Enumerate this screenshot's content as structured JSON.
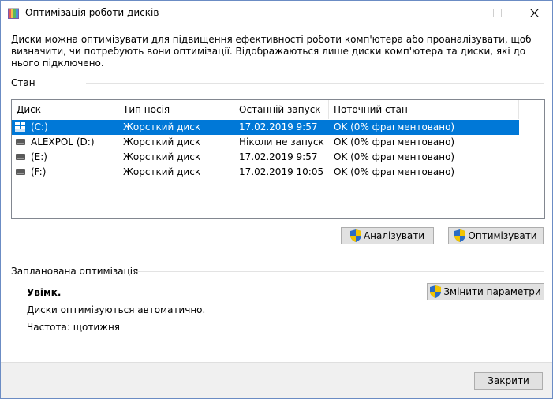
{
  "window": {
    "title": "Оптимізація роботи дисків"
  },
  "description": "Диски можна оптимізувати для підвищення ефективності роботи комп'ютера або проаналізувати, щоб визначити, чи потребують вони оптимізації. Відображаються лише диски комп'ютера та диски, які до нього підключено.",
  "status_section": {
    "label": "Стан",
    "columns": [
      "Диск",
      "Тип носія",
      "Останній запуск",
      "Поточний стан"
    ],
    "drives": [
      {
        "disk": "(C:)",
        "media": "Жорсткий диск",
        "last_run": "17.02.2019 9:57",
        "status": "OK (0% фрагментовано)",
        "icon": "windows-drive-icon",
        "selected": true
      },
      {
        "disk": "ALEXPOL (D:)",
        "media": "Жорсткий диск",
        "last_run": "Ніколи не запуск...",
        "status": "OK (0% фрагментовано)",
        "icon": "drive-icon",
        "selected": false
      },
      {
        "disk": "(E:)",
        "media": "Жорсткий диск",
        "last_run": "17.02.2019 9:57",
        "status": "OK (0% фрагментовано)",
        "icon": "drive-icon",
        "selected": false
      },
      {
        "disk": "(F:)",
        "media": "Жорсткий диск",
        "last_run": "17.02.2019 10:05",
        "status": "OK (0% фрагментовано)",
        "icon": "drive-icon",
        "selected": false
      }
    ],
    "analyze_label": "Аналізувати",
    "optimize_label": "Оптимізувати"
  },
  "schedule_section": {
    "label": "Запланована оптимізація",
    "state": "Увімк.",
    "auto_text": "Диски оптимізуються автоматично.",
    "frequency": "Частота: щотижня",
    "change_label": "Змінити параметри"
  },
  "footer": {
    "close_label": "Закрити"
  },
  "colors": {
    "selection": "#0078d7",
    "button_face": "#e1e1e1",
    "footer_bg": "#f0f0f0"
  }
}
